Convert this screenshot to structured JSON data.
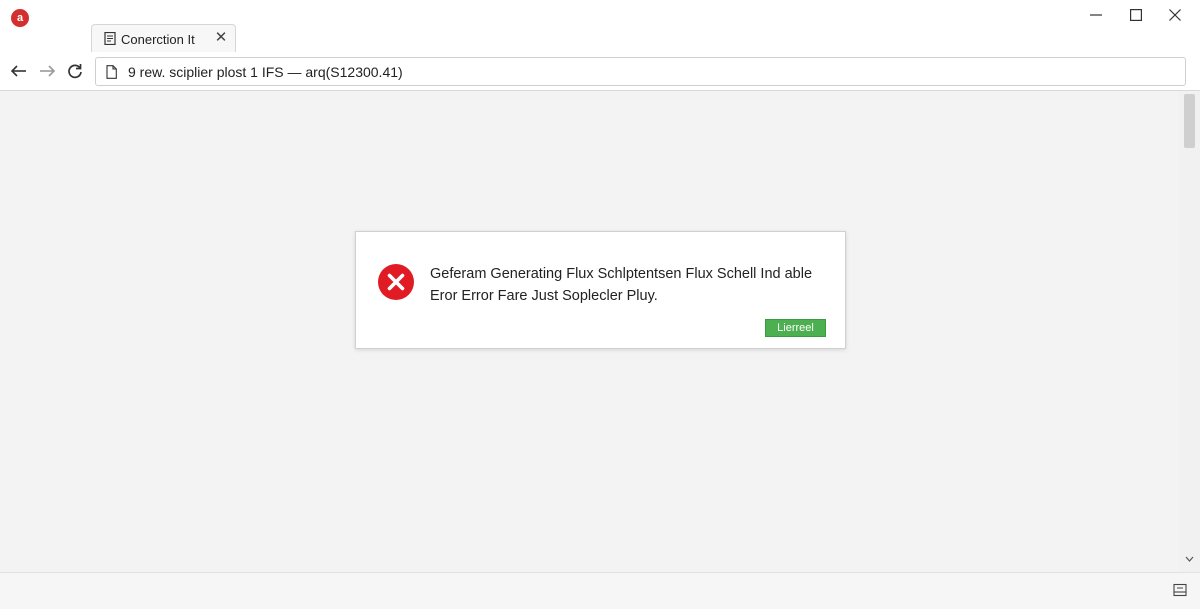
{
  "window": {
    "tab_title": "Conerction It",
    "tab_close": "✕"
  },
  "navigation": {
    "address_text": "9  rew. sciplier plost 1 IFS — arq(S12300.41)"
  },
  "dialog": {
    "message_line1": "Geferam Generating Flux Schlptentsen Flux Schell Ind able",
    "message_line2": "Eror Error Fare Just Soplecler Pluy.",
    "button_label": "Lierreel"
  },
  "colors": {
    "app_icon": "#d32f2f",
    "error_icon": "#e01b24",
    "button": "#4caf50",
    "page_background": "#f3f3f3"
  },
  "icons": {
    "app": "app-logo-icon",
    "error": "error-x-icon",
    "back": "back-arrow-icon",
    "forward": "forward-arrow-icon",
    "reload": "reload-icon",
    "page": "page-icon"
  }
}
